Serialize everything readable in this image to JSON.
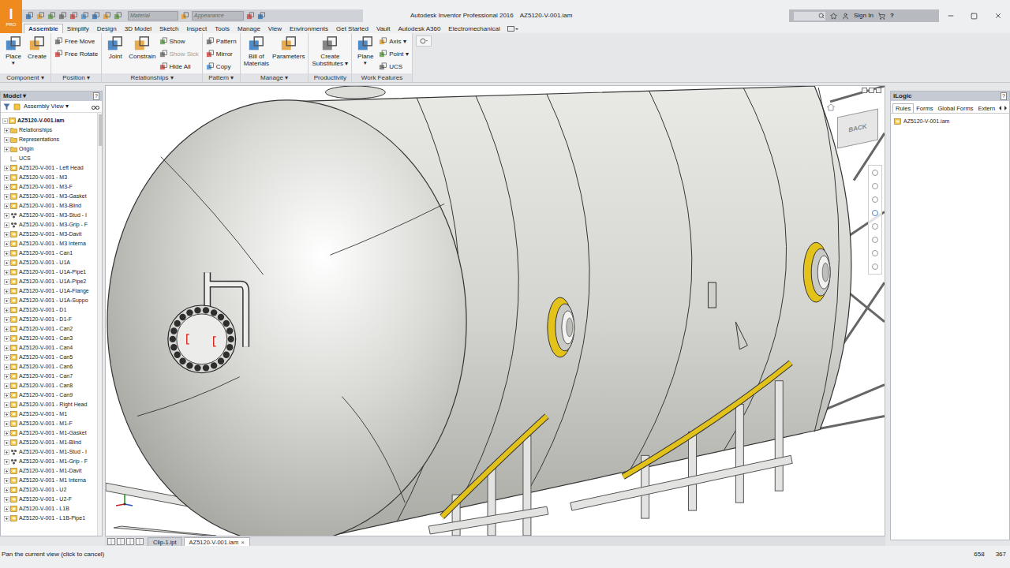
{
  "app": {
    "logo": "I",
    "logo_sub": "PRO"
  },
  "window": {
    "app": "Autodesk Inventor Professional 2016",
    "document": "AZ5120-V-001.iam"
  },
  "quick_access": {
    "material": "Material",
    "appearance": "Appearance"
  },
  "account": {
    "sign_in": "Sign In",
    "help": "?"
  },
  "ribbon_tabs": [
    {
      "label": "Assemble",
      "selected": true
    },
    {
      "label": "Simplify",
      "selected": false
    },
    {
      "label": "Design",
      "selected": false
    },
    {
      "label": "3D Model",
      "selected": false
    },
    {
      "label": "Sketch",
      "selected": false
    },
    {
      "label": "Inspect",
      "selected": false
    },
    {
      "label": "Tools",
      "selected": false
    },
    {
      "label": "Manage",
      "selected": false
    },
    {
      "label": "View",
      "selected": false
    },
    {
      "label": "Environments",
      "selected": false
    },
    {
      "label": "Get Started",
      "selected": false
    },
    {
      "label": "Vault",
      "selected": false
    },
    {
      "label": "Autodesk A360",
      "selected": false
    },
    {
      "label": "Electromechanical",
      "selected": false
    }
  ],
  "ribbon": {
    "menu_glyph": "▾",
    "groups": [
      {
        "label": "Component",
        "dropdown": true,
        "buttons": [
          {
            "kind": "large",
            "lines": [
              "Place"
            ],
            "arrow": true,
            "disabled": false
          },
          {
            "kind": "large",
            "lines": [
              "Create"
            ],
            "arrow": false,
            "disabled": false
          }
        ]
      },
      {
        "label": "Position",
        "dropdown": true,
        "buttons": [
          {
            "kind": "small",
            "lines": [
              "Free Move"
            ],
            "arrow": false,
            "disabled": false
          },
          {
            "kind": "small",
            "lines": [
              "Free Rotate"
            ],
            "arrow": false,
            "disabled": false
          }
        ]
      },
      {
        "label": "Relationships",
        "dropdown": true,
        "buttons": [
          {
            "kind": "large",
            "lines": [
              "Joint"
            ],
            "arrow": false,
            "disabled": false
          },
          {
            "kind": "large",
            "lines": [
              "Constrain"
            ],
            "arrow": false,
            "disabled": false
          },
          {
            "kind": "small",
            "lines": [
              "Show"
            ],
            "arrow": false,
            "disabled": false
          },
          {
            "kind": "small",
            "lines": [
              "Show Sick"
            ],
            "arrow": false,
            "disabled": true
          },
          {
            "kind": "small",
            "lines": [
              "Hide All"
            ],
            "arrow": false,
            "disabled": false
          }
        ]
      },
      {
        "label": "Pattern",
        "dropdown": true,
        "buttons": [
          {
            "kind": "small",
            "lines": [
              "Pattern"
            ],
            "arrow": false,
            "disabled": false
          },
          {
            "kind": "small",
            "lines": [
              "Mirror"
            ],
            "arrow": false,
            "disabled": false
          },
          {
            "kind": "small",
            "lines": [
              "Copy"
            ],
            "arrow": false,
            "disabled": false
          }
        ]
      },
      {
        "label": "Manage",
        "dropdown": true,
        "buttons": [
          {
            "kind": "large",
            "lines": [
              "Bill of",
              "Materials"
            ],
            "arrow": false,
            "disabled": false
          },
          {
            "kind": "large",
            "lines": [
              "Parameters"
            ],
            "arrow": false,
            "disabled": false
          }
        ]
      },
      {
        "label": "Productivity",
        "dropdown": false,
        "buttons": [
          {
            "kind": "large",
            "lines": [
              "Create",
              "Substitutes"
            ],
            "arrow": true,
            "disabled": false
          }
        ]
      },
      {
        "label": "Work Features",
        "dropdown": false,
        "buttons": [
          {
            "kind": "large",
            "lines": [
              "Plane"
            ],
            "arrow": true,
            "disabled": false
          },
          {
            "kind": "small",
            "lines": [
              "Axis"
            ],
            "arrow": true,
            "disabled": false
          },
          {
            "kind": "small",
            "lines": [
              "Point"
            ],
            "arrow": true,
            "disabled": false
          },
          {
            "kind": "small",
            "lines": [
              "UCS"
            ],
            "arrow": false,
            "disabled": false
          }
        ]
      }
    ]
  },
  "model_panel": {
    "title": "Model",
    "help": "?",
    "view": "Assembly View",
    "tree": [
      {
        "label": "AZ5120-V-001.iam",
        "kind": "root",
        "expanded": true
      },
      {
        "label": "Relationships",
        "kind": "folder",
        "expanded": false
      },
      {
        "label": "Representations",
        "kind": "folder",
        "expanded": false
      },
      {
        "label": "Origin",
        "kind": "folder",
        "expanded": false
      },
      {
        "label": "UCS",
        "kind": "ucs",
        "expanded": false
      },
      {
        "label": "AZ5120-V-001 - Left Head",
        "kind": "part",
        "expanded": false
      },
      {
        "label": "AZ5120-V-001 - M3",
        "kind": "part",
        "expanded": false
      },
      {
        "label": "AZ5120-V-001 - M3-F",
        "kind": "part",
        "expanded": false
      },
      {
        "label": "AZ5120-V-001 - M3-Gasket",
        "kind": "part",
        "expanded": false
      },
      {
        "label": "AZ5120-V-001 - M3-Blind",
        "kind": "part",
        "expanded": false
      },
      {
        "label": "AZ5120-V-001 - M3-Stud - I",
        "kind": "pattern",
        "expanded": false
      },
      {
        "label": "AZ5120-V-001 - M3-Grip - F",
        "kind": "pattern",
        "expanded": false
      },
      {
        "label": "AZ5120-V-001 - M3-Davit",
        "kind": "part",
        "expanded": false
      },
      {
        "label": "AZ5120-V-001 - M3 Interna",
        "kind": "part",
        "expanded": false
      },
      {
        "label": "AZ5120-V-001 - Can1",
        "kind": "part",
        "expanded": false
      },
      {
        "label": "AZ5120-V-001 - U1A",
        "kind": "part",
        "expanded": false
      },
      {
        "label": "AZ5120-V-001 - U1A-Pipe1",
        "kind": "part",
        "expanded": false
      },
      {
        "label": "AZ5120-V-001 - U1A-Pipe2",
        "kind": "part",
        "expanded": false
      },
      {
        "label": "AZ5120-V-001 - U1A-Flange",
        "kind": "part",
        "expanded": false
      },
      {
        "label": "AZ5120-V-001 - U1A-Suppo",
        "kind": "part",
        "expanded": false
      },
      {
        "label": "AZ5120-V-001 - D1",
        "kind": "part",
        "expanded": false
      },
      {
        "label": "AZ5120-V-001 - D1-F",
        "kind": "part",
        "expanded": false
      },
      {
        "label": "AZ5120-V-001 - Can2",
        "kind": "part",
        "expanded": false
      },
      {
        "label": "AZ5120-V-001 - Can3",
        "kind": "part",
        "expanded": false
      },
      {
        "label": "AZ5120-V-001 - Can4",
        "kind": "part",
        "expanded": false
      },
      {
        "label": "AZ5120-V-001 - Can5",
        "kind": "part",
        "expanded": false
      },
      {
        "label": "AZ5120-V-001 - Can6",
        "kind": "part",
        "expanded": false
      },
      {
        "label": "AZ5120-V-001 - Can7",
        "kind": "part",
        "expanded": false
      },
      {
        "label": "AZ5120-V-001 - Can8",
        "kind": "part",
        "expanded": false
      },
      {
        "label": "AZ5120-V-001 - Can9",
        "kind": "part",
        "expanded": false
      },
      {
        "label": "AZ5120-V-001 - Right Head",
        "kind": "part",
        "expanded": false
      },
      {
        "label": "AZ5120-V-001 - M1",
        "kind": "part",
        "expanded": false
      },
      {
        "label": "AZ5120-V-001 - M1-F",
        "kind": "part",
        "expanded": false
      },
      {
        "label": "AZ5120-V-001 - M1-Gasket",
        "kind": "part",
        "expanded": false
      },
      {
        "label": "AZ5120-V-001 - M1-Blind",
        "kind": "part",
        "expanded": false
      },
      {
        "label": "AZ5120-V-001 - M1-Stud - I",
        "kind": "pattern",
        "expanded": false
      },
      {
        "label": "AZ5120-V-001 - M1-Grip - F",
        "kind": "pattern",
        "expanded": false
      },
      {
        "label": "AZ5120-V-001 - M1-Davit",
        "kind": "part",
        "expanded": false
      },
      {
        "label": "AZ5120-V-001 - M1 Interna",
        "kind": "part",
        "expanded": false
      },
      {
        "label": "AZ5120-V-001 - U2",
        "kind": "part",
        "expanded": false
      },
      {
        "label": "AZ5120-V-001 - U2-F",
        "kind": "part",
        "expanded": false
      },
      {
        "label": "AZ5120-V-001 - L1B",
        "kind": "part",
        "expanded": false
      },
      {
        "label": "AZ5120-V-001 - L1B-Pipe1",
        "kind": "part",
        "expanded": false
      }
    ]
  },
  "viewport": {
    "viewcube": "BACK"
  },
  "doc_tabs": [
    {
      "label": "Clip-1.ipt",
      "selected": false,
      "close": ""
    },
    {
      "label": "AZ5120-V-001.iam",
      "selected": true,
      "close": "×"
    }
  ],
  "ilogic": {
    "title": "iLogic",
    "help": "?",
    "tabs": [
      {
        "label": "Rules",
        "selected": true
      },
      {
        "label": "Forms",
        "selected": false
      },
      {
        "label": "Global Forms",
        "selected": false
      },
      {
        "label": "Extern",
        "selected": false
      }
    ],
    "items": [
      "AZ5120-V-001.iam"
    ]
  },
  "status_bar": {
    "message": "Pan the current view (click to cancel)",
    "x": "658",
    "y": "367"
  }
}
